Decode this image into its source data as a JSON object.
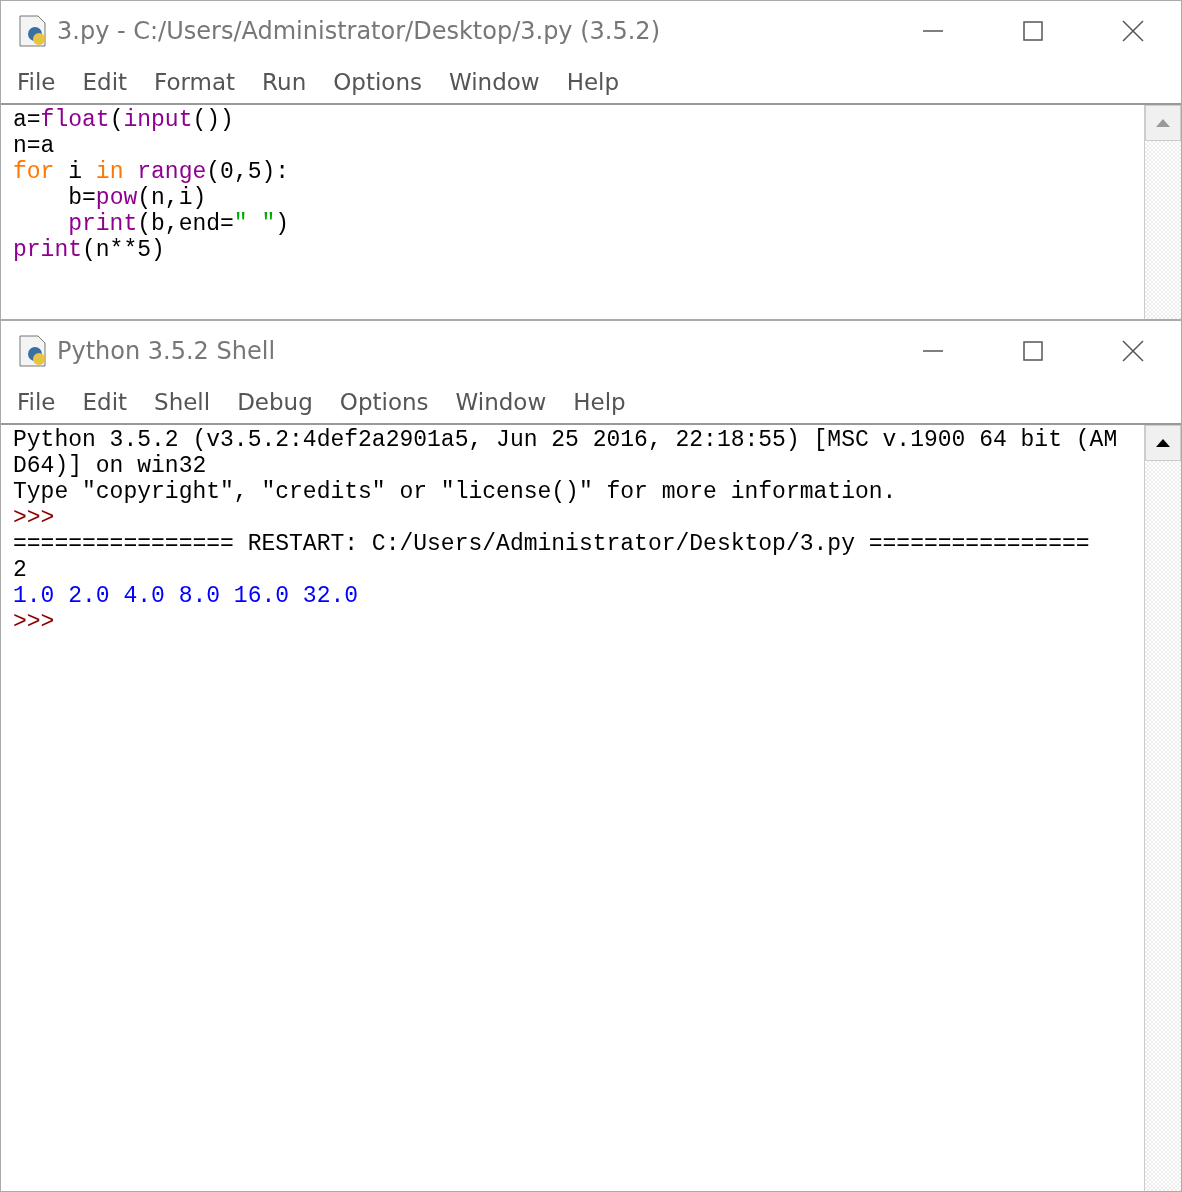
{
  "windows": [
    {
      "title": "3.py - C:/Users/Administrator/Desktop/3.py (3.5.2)",
      "menu": [
        "File",
        "Edit",
        "Format",
        "Run",
        "Options",
        "Window",
        "Help"
      ],
      "scroll_up_enabled": false,
      "grow": false,
      "lines": [
        [
          {
            "text": "a=",
            "kind": "plain"
          },
          {
            "text": "float",
            "kind": "builtin"
          },
          {
            "text": "(",
            "kind": "plain"
          },
          {
            "text": "input",
            "kind": "builtin"
          },
          {
            "text": "())",
            "kind": "plain"
          }
        ],
        [
          {
            "text": "n=a",
            "kind": "plain"
          }
        ],
        [
          {
            "text": "for",
            "kind": "keyword"
          },
          {
            "text": " i ",
            "kind": "plain"
          },
          {
            "text": "in",
            "kind": "keyword"
          },
          {
            "text": " range",
            "kind": "builtin"
          },
          {
            "text": "(0,5):",
            "kind": "plain"
          }
        ],
        [
          {
            "text": "    b=",
            "kind": "plain"
          },
          {
            "text": "pow",
            "kind": "builtin"
          },
          {
            "text": "(n,i)",
            "kind": "plain"
          }
        ],
        [
          {
            "text": "    print",
            "kind": "builtin"
          },
          {
            "text": "(b,end=",
            "kind": "plain"
          },
          {
            "text": "\" \"",
            "kind": "string"
          },
          {
            "text": ")",
            "kind": "plain"
          }
        ],
        [
          {
            "text": "print",
            "kind": "builtin"
          },
          {
            "text": "(n**5)",
            "kind": "plain"
          }
        ]
      ]
    },
    {
      "title": "Python 3.5.2 Shell",
      "menu": [
        "File",
        "Edit",
        "Shell",
        "Debug",
        "Options",
        "Window",
        "Help"
      ],
      "scroll_up_enabled": true,
      "grow": true,
      "lines": [
        [
          {
            "text": "Python 3.5.2 (v3.5.2:4def2a2901a5, Jun 25 2016, 22:18:55) [MSC v.1900 64 bit (AM",
            "kind": "plain"
          }
        ],
        [
          {
            "text": "D64)] on win32",
            "kind": "plain"
          }
        ],
        [
          {
            "text": "Type \"copyright\", \"credits\" or \"license()\" for more information.",
            "kind": "plain"
          }
        ],
        [
          {
            "text": ">>> ",
            "kind": "prompt"
          }
        ],
        [
          {
            "text": "================ RESTART: C:/Users/Administrator/Desktop/3.py ================",
            "kind": "plain"
          }
        ],
        [
          {
            "text": "2",
            "kind": "plain"
          }
        ],
        [
          {
            "text": "1.0 2.0 4.0 8.0 16.0 32.0",
            "kind": "output"
          }
        ],
        [
          {
            "text": ">>> ",
            "kind": "prompt"
          }
        ]
      ]
    }
  ]
}
